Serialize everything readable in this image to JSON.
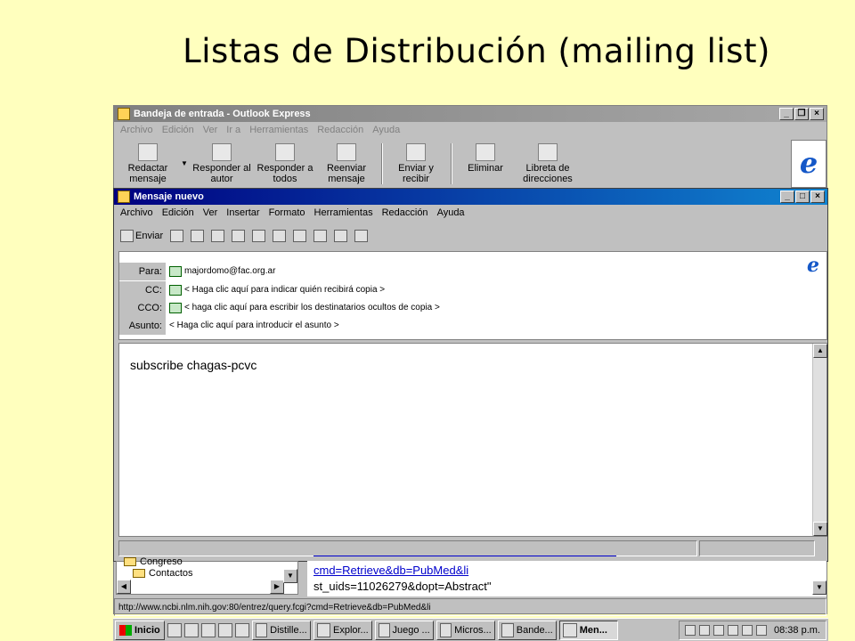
{
  "slide": {
    "title": "Listas de Distribución (mailing list)"
  },
  "outlook": {
    "title": "Bandeja de entrada - Outlook Express",
    "menu": [
      "Archivo",
      "Edición",
      "Ver",
      "Ir a",
      "Herramientas",
      "Redacción",
      "Ayuda"
    ],
    "toolbar": [
      {
        "name": "new-mail",
        "l1": "Redactar",
        "l2": "mensaje"
      },
      {
        "name": "reply-author",
        "l1": "Responder al",
        "l2": "autor"
      },
      {
        "name": "reply-all",
        "l1": "Responder a",
        "l2": "todos"
      },
      {
        "name": "forward",
        "l1": "Reenviar",
        "l2": "mensaje"
      },
      {
        "name": "send-receive",
        "l1": "Enviar y",
        "l2": "recibir"
      },
      {
        "name": "delete",
        "l1": "Eliminar",
        "l2": ""
      },
      {
        "name": "address-book",
        "l1": "Libreta de",
        "l2": "direcciones"
      }
    ]
  },
  "compose": {
    "title": "Mensaje nuevo",
    "menu": [
      "Archivo",
      "Edición",
      "Ver",
      "Insertar",
      "Formato",
      "Herramientas",
      "Redacción",
      "Ayuda"
    ],
    "send_label": "Enviar",
    "labels": {
      "to": "Para:",
      "cc": "CC:",
      "bcc": "CCO:",
      "subject": "Asunto:"
    },
    "to": "majordomo@fac.org.ar",
    "cc": "< Haga clic aquí para indicar quién recibirá copia >",
    "bcc": "< haga clic aquí para escribir los destinatarios ocultos de copia >",
    "subject": "< Haga clic aquí para introducir el asunto >",
    "body": "subscribe chagas-pcvc"
  },
  "folders": [
    "Congreso",
    "Contactos"
  ],
  "preview": {
    "link1": "cmd=Retrieve&db=PubMed&li",
    "line2": "st_uids=11026279&dopt=Abstract\""
  },
  "status_url": "http://www.ncbi.nlm.nih.gov:80/entrez/query.fcgi?cmd=Retrieve&db=PubMed&li",
  "taskbar": {
    "start": "Inicio",
    "tasks": [
      "Distille...",
      "Explor...",
      "Juego ...",
      "Micros...",
      "Bande...",
      "Men..."
    ],
    "clock": "08:38 p.m."
  }
}
